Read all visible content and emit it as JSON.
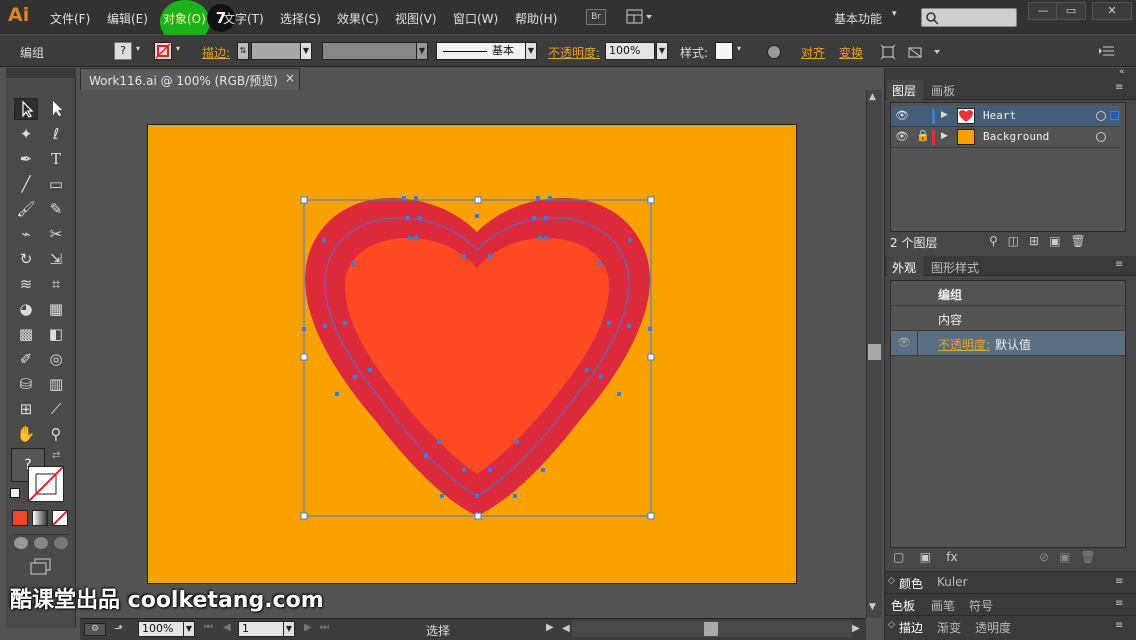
{
  "app": {
    "logo": "Ai"
  },
  "menu": {
    "items": [
      "文件(F)",
      "编辑(E)",
      "对象(O)",
      "文字(T)",
      "选择(S)",
      "效果(C)",
      "视图(V)",
      "窗口(W)",
      "帮助(H)"
    ],
    "step_badge": "7",
    "bridge_label": "Br",
    "workspace": "基本功能"
  },
  "control": {
    "selection_label": "编组",
    "stroke_label": "描边:",
    "stroke_style": "基本",
    "opacity_label": "不透明度:",
    "opacity_value": "100%",
    "style_label": "样式:",
    "align_label": "对齐",
    "transform_label": "变换",
    "fill_unknown": "?"
  },
  "document": {
    "tab_title": "Work116.ai @ 100% (RGB/预览)",
    "close": "×"
  },
  "status": {
    "zoom": "100%",
    "page": "1",
    "tool": "选择"
  },
  "tools": {
    "fill_unknown": "?"
  },
  "layers_panel": {
    "tabs": [
      "图层",
      "画板"
    ],
    "layers": [
      {
        "name": "Heart",
        "color": "#3a7de0"
      },
      {
        "name": "Background",
        "color": "#e03030"
      }
    ],
    "count_label": "2 个图层"
  },
  "appearance_panel": {
    "tabs": [
      "外观",
      "图形样式"
    ],
    "header": "编组",
    "content": "内容",
    "opacity_label": "不透明度:",
    "opacity_value": "默认值"
  },
  "color_panel": {
    "tabs": [
      "颜色",
      "Kuler"
    ]
  },
  "swatch_panel": {
    "tabs": [
      "色板",
      "画笔",
      "符号"
    ]
  },
  "stroke_panel": {
    "tabs": [
      "描边",
      "渐变",
      "透明度"
    ]
  },
  "watermark": "酷课堂出品 coolketang.com",
  "colors": {
    "artboard": "#fba200",
    "heart_outer": "#dc2a3c",
    "heart_inner": "#fd4a22",
    "selection": "#3a7de0"
  }
}
